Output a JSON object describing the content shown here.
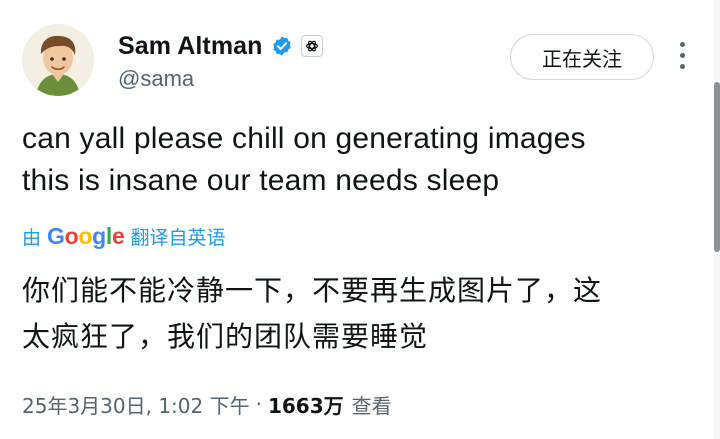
{
  "author": {
    "name": "Sam Altman",
    "handle": "@sama"
  },
  "actions": {
    "follow_label": "正在关注"
  },
  "tweet": {
    "lines": [
      "can yall please chill on generating images",
      "this is insane our team needs sleep"
    ]
  },
  "translation": {
    "by_label": "由",
    "provider_letters": [
      "G",
      "o",
      "o",
      "g",
      "l",
      "e"
    ],
    "from_label": "翻译自英语",
    "lines": [
      "你们能不能冷静一下，不要再生成图片了，这",
      "太疯狂了，我们的团队需要睡觉"
    ]
  },
  "meta": {
    "timestamp": "25年3月30日, 1:02 下午",
    "separator": "·",
    "views_count": "1663万",
    "views_label": "查看"
  },
  "colors": {
    "verified": "#1d9bf0",
    "link": "#1d9bf0",
    "secondary_text": "#536471"
  },
  "icons": {
    "verified": "verified-badge-icon",
    "org": "openai-logo-icon",
    "more": "more-vertical-icon"
  }
}
